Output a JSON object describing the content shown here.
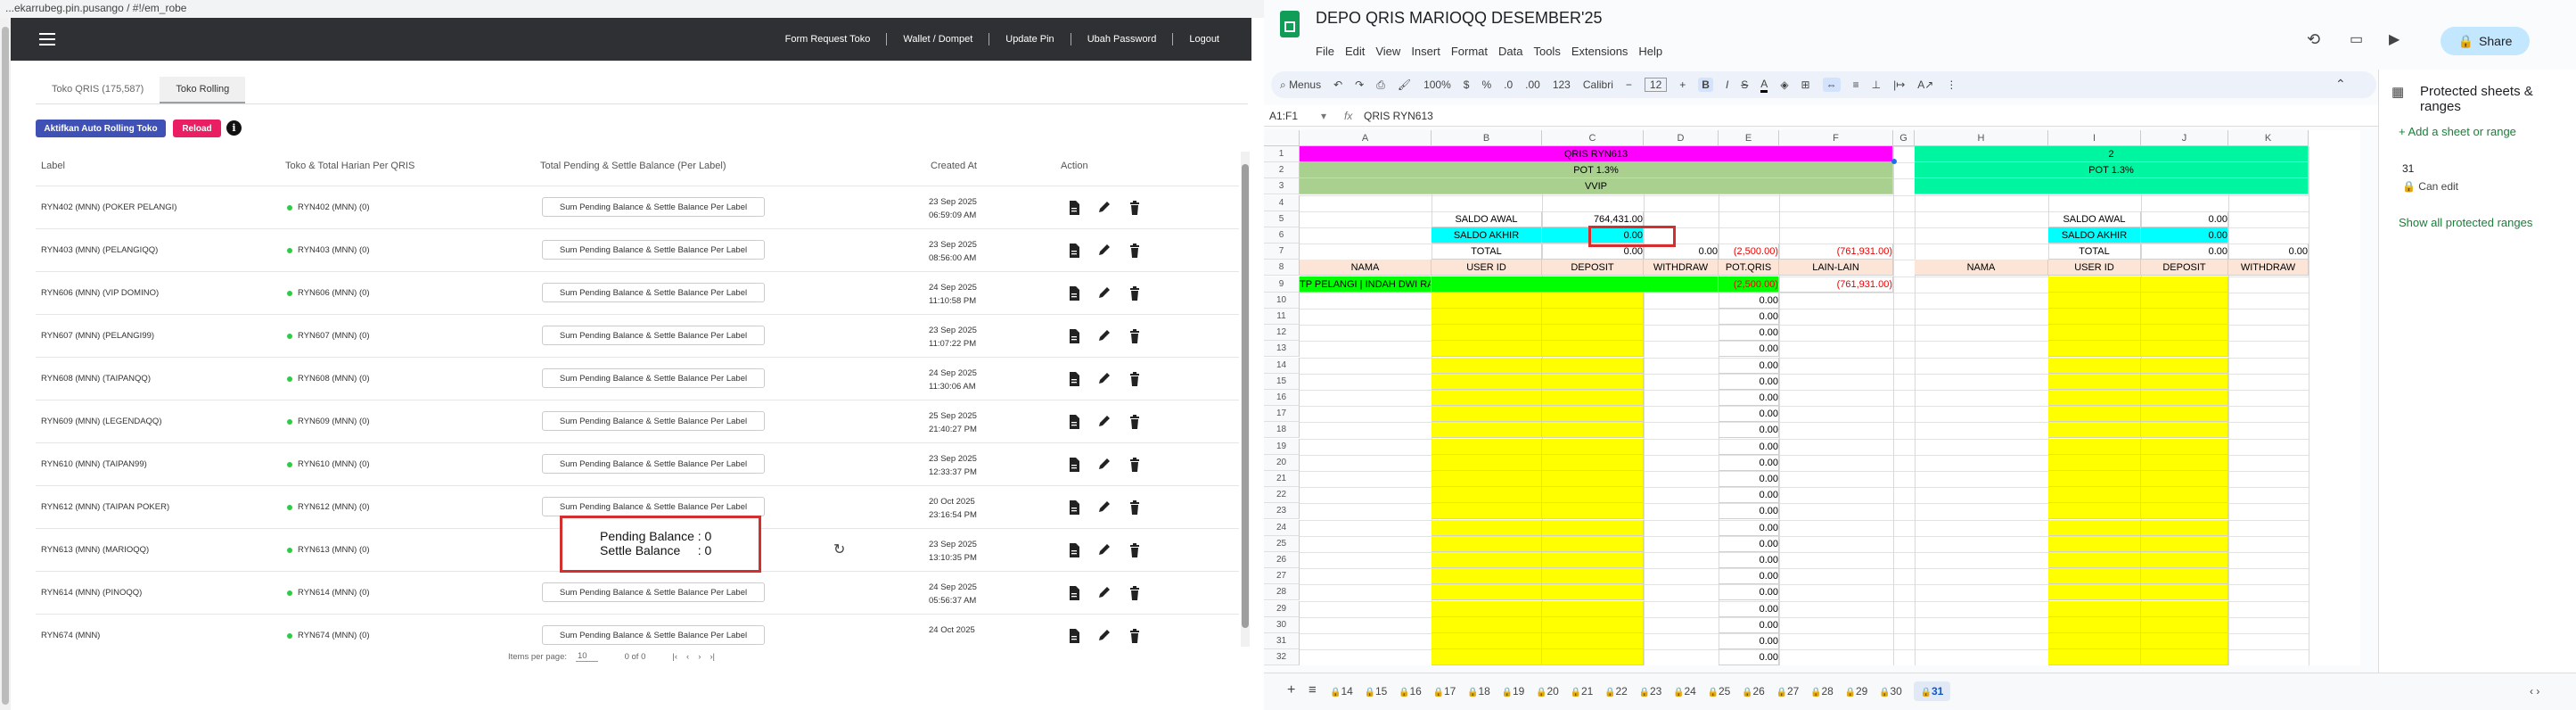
{
  "browser_left": {
    "url": "...ekarrubeg.pin.pusango / #!/em_robe"
  },
  "admin": {
    "nav": [
      "Form Request Toko",
      "Wallet / Dompet",
      "Update Pin",
      "Ubah Password",
      "Logout"
    ],
    "tabs": [
      "Toko QRIS (175,587)",
      "Toko Rolling"
    ],
    "buttons": {
      "aktif": "Aktifkan Auto Rolling Toko",
      "reload": "Reload",
      "info": "i"
    },
    "headers": {
      "label": "Label",
      "toko": "Toko & Total Harian Per QRIS",
      "total": "Total Pending & Settle Balance (Per Label)",
      "created": "Created At",
      "action": "Action"
    },
    "sum_label": "Sum Pending Balance & Settle Balance Per Label",
    "rows": [
      {
        "label": "RYN402 (MNN) (POKER PELANGI)",
        "toko": "RYN402 (MNN) (0)",
        "d1": "23 Sep 2025",
        "d2": "06:59:09 AM"
      },
      {
        "label": "RYN403 (MNN) (PELANGIQQ)",
        "toko": "RYN403 (MNN) (0)",
        "d1": "23 Sep 2025",
        "d2": "08:56:00 AM"
      },
      {
        "label": "RYN606 (MNN) (VIP DOMINO)",
        "toko": "RYN606 (MNN) (0)",
        "d1": "24 Sep 2025",
        "d2": "11:10:58 PM"
      },
      {
        "label": "RYN607 (MNN) (PELANGI99)",
        "toko": "RYN607 (MNN) (0)",
        "d1": "23 Sep 2025",
        "d2": "11:07:22 PM"
      },
      {
        "label": "RYN608 (MNN) (TAIPANQQ)",
        "toko": "RYN608 (MNN) (0)",
        "d1": "24 Sep 2025",
        "d2": "11:30:06 AM"
      },
      {
        "label": "RYN609 (MNN) (LEGENDAQQ)",
        "toko": "RYN609 (MNN) (0)",
        "d1": "25 Sep 2025",
        "d2": "21:40:27 PM"
      },
      {
        "label": "RYN610 (MNN) (TAIPAN99)",
        "toko": "RYN610 (MNN) (0)",
        "d1": "23 Sep 2025",
        "d2": "12:33:37 PM"
      },
      {
        "label": "RYN612 (MNN) (TAIPAN POKER)",
        "toko": "RYN612 (MNN) (0)",
        "d1": "20 Oct 2025",
        "d2": "23:16:54 PM"
      },
      {
        "label": "RYN613 (MNN) (MARIOQQ)",
        "toko": "RYN613 (MNN) (0)",
        "d1": "23 Sep 2025",
        "d2": "13:10:35 PM"
      },
      {
        "label": "RYN614 (MNN) (PINOQQ)",
        "toko": "RYN614 (MNN) (0)",
        "d1": "24 Sep 2025",
        "d2": "05:56:37 AM"
      },
      {
        "label": "RYN674 (MNN)",
        "toko": "RYN674 (MNN) (0)",
        "d1": "24 Oct 2025",
        "d2": ""
      }
    ],
    "popup": {
      "pending": "Pending Balance : 0",
      "settle": "Settle Balance     : 0"
    },
    "pager": {
      "items_label": "Items per page:",
      "items": "10",
      "range": "0 of 0"
    }
  },
  "sheets": {
    "title": "DEPO QRIS MARIOQQ DESEMBER'25",
    "menu": [
      "File",
      "Edit",
      "View",
      "Insert",
      "Format",
      "Data",
      "Tools",
      "Extensions",
      "Help"
    ],
    "share": "Share",
    "toolbar": {
      "menus": "Menus",
      "zoom": "100%",
      "font": "Calibri",
      "size": "12",
      "pct": "%",
      "cur": "$",
      "dec0": ".0",
      "dec00": ".00",
      "num": "123"
    },
    "namebox": "A1:F1",
    "formula": "QRIS RYN613",
    "cols": [
      "A",
      "B",
      "C",
      "D",
      "E",
      "F",
      "G",
      "H",
      "I",
      "J",
      "K"
    ],
    "block1": {
      "title": "QRIS RYN613",
      "pot": "POT 1.3%",
      "vvip": "VVIP",
      "saldo_awal": "SALDO AWAL",
      "saldo_awal_v": "764,431.00",
      "saldo_akhir": "SALDO AKHIR",
      "saldo_akhir_v": "0.00",
      "total": "TOTAL",
      "total_c": "0.00",
      "total_d": "0.00",
      "total_e": "(2,500.00)",
      "total_f": "(761,931.00)",
      "h_nama": "NAMA",
      "h_user": "USER ID",
      "h_dep": "DEPOSIT",
      "h_wd": "WITHDRAW",
      "h_pot": "POT.QRIS",
      "h_lain": "LAIN-LAIN",
      "r9_nama": "TP PELANGI | INDAH DWI RAMADHANI",
      "r9_e": "(2,500.00)",
      "r9_f": "(761,931.00)",
      "zero": "0.00"
    },
    "block2": {
      "title": "2",
      "pot": "POT 1.3%",
      "saldo_awal": "SALDO AWAL",
      "saldo_awal_v": "0.00",
      "saldo_akhir": "SALDO AKHIR",
      "saldo_akhir_v": "0.00",
      "total": "TOTAL",
      "total_j": "0.00",
      "total_k": "0.00",
      "h_nama": "NAMA",
      "h_user": "USER ID",
      "h_dep": "DEPOSIT",
      "h_wd": "WITHDRAW"
    },
    "side": {
      "title": "Protected sheets & ranges",
      "add": "+ Add a sheet or range",
      "num": "31",
      "can": "Can edit",
      "show": "Show all protected ranges"
    },
    "sheet_tabs": [
      "14",
      "15",
      "16",
      "17",
      "18",
      "19",
      "20",
      "21",
      "22",
      "23",
      "24",
      "25",
      "26",
      "27",
      "28",
      "29",
      "30",
      "31"
    ],
    "colors": {
      "magenta": "#ff00ff",
      "green_light": "#a9d08e",
      "mint": "#00f5a0",
      "cyan": "#00ffff",
      "yellow": "#ffff00",
      "peach": "#fce4d6",
      "bright_green": "#00ff00"
    }
  }
}
